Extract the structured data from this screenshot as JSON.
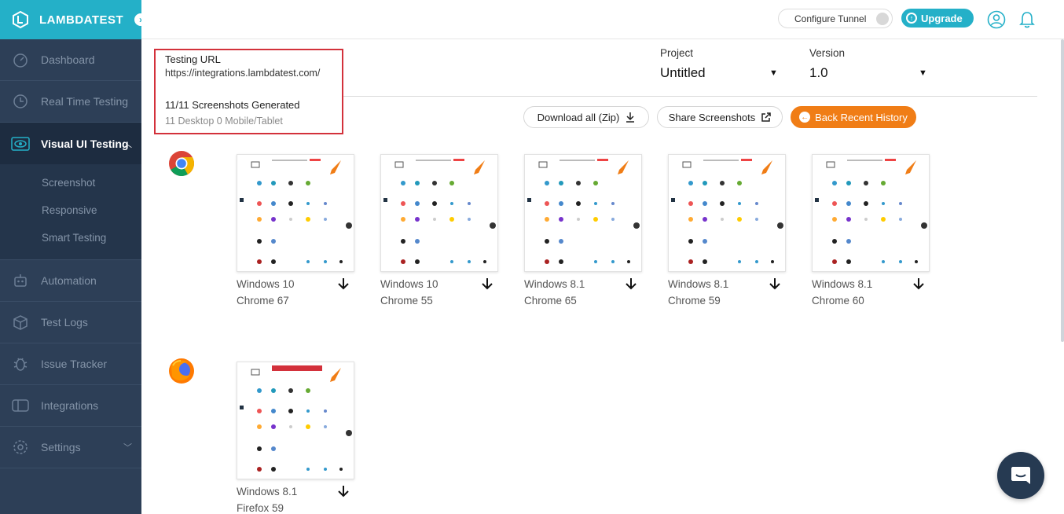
{
  "brand": {
    "name": "LAMBDATEST"
  },
  "sidebar": {
    "items": [
      {
        "label": "Dashboard",
        "icon": "dashboard-gauge-icon"
      },
      {
        "label": "Real Time Testing",
        "icon": "clock-icon"
      },
      {
        "label": "Visual UI Testing",
        "icon": "eye-icon",
        "active": true
      },
      {
        "label": "Automation",
        "icon": "robot-icon"
      },
      {
        "label": "Test Logs",
        "icon": "box-icon"
      },
      {
        "label": "Issue Tracker",
        "icon": "bug-icon"
      },
      {
        "label": "Integrations",
        "icon": "integrations-icon"
      },
      {
        "label": "Settings",
        "icon": "gear-icon"
      }
    ],
    "submenu": [
      "Screenshot",
      "Responsive",
      "Smart Testing"
    ]
  },
  "topbar": {
    "tunnel_label": "Configure Tunnel",
    "upgrade_label": "Upgrade"
  },
  "info": {
    "testing_url_label": "Testing URL",
    "testing_url": "https://integrations.lambdatest.com/",
    "generated": "11/11 Screenshots Generated",
    "breakdown": "11 Desktop 0 Mobile/Tablet"
  },
  "project": {
    "label": "Project",
    "value": "Untitled"
  },
  "version": {
    "label": "Version",
    "value": "1.0"
  },
  "actions": {
    "download_all": "Download all (Zip)",
    "share": "Share Screenshots",
    "back": "Back Recent History"
  },
  "colors": {
    "accent": "#24b0c8",
    "sidebar": "#2d3f57",
    "orange": "#f07d16",
    "highlight": "#d3313b"
  },
  "rows": [
    {
      "browser": "chrome-icon",
      "cards": [
        {
          "os": "Windows 10",
          "browser": "Chrome 67"
        },
        {
          "os": "Windows 10",
          "browser": "Chrome 55"
        },
        {
          "os": "Windows 8.1",
          "browser": "Chrome 65"
        },
        {
          "os": "Windows 8.1",
          "browser": "Chrome 59"
        },
        {
          "os": "Windows 8.1",
          "browser": "Chrome 60"
        }
      ]
    },
    {
      "browser": "firefox-icon",
      "cards": [
        {
          "os": "Windows 8.1",
          "browser": "Firefox 59"
        }
      ]
    }
  ]
}
